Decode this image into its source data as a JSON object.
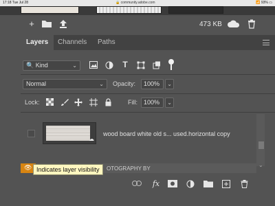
{
  "status_bar": {
    "time": "17:18",
    "date": "Tue Jul 28",
    "url": "community.adobe.com",
    "battery": "93%"
  },
  "toolbar": {
    "file_size": "473 KB",
    "icons": [
      "add-icon",
      "folder-icon",
      "upload-icon",
      "cloud-icon",
      "trash-icon"
    ]
  },
  "panel": {
    "tabs": [
      {
        "label": "Layers",
        "active": true
      },
      {
        "label": "Channels",
        "active": false
      },
      {
        "label": "Paths",
        "active": false
      }
    ],
    "filter": {
      "kind_label": "Kind",
      "icons": [
        "image-filter-icon",
        "adjustment-filter-icon",
        "type-filter-icon",
        "shape-filter-icon",
        "smart-object-filter-icon",
        "toggle-filter-icon"
      ]
    },
    "blend_mode": "Normal",
    "opacity_label": "Opacity:",
    "opacity_value": "100%",
    "lock_label": "Lock:",
    "fill_label": "Fill:",
    "fill_value": "100%"
  },
  "layers": [
    {
      "name": "wood board white old s... used.horizontal copy",
      "visible": false
    },
    {
      "name": "OTOGRAPHY BY",
      "visible": true
    }
  ],
  "tooltip": "Indicates layer visibility",
  "bottom_icons": [
    "link-icon",
    "fx-icon",
    "mask-icon",
    "adjustment-icon",
    "group-icon",
    "new-layer-icon",
    "trash-icon"
  ],
  "colors": {
    "panel_bg": "#535353",
    "tab_bar_bg": "#424242",
    "visibility_active": "#d88512",
    "tooltip_bg": "#fff7c0"
  }
}
